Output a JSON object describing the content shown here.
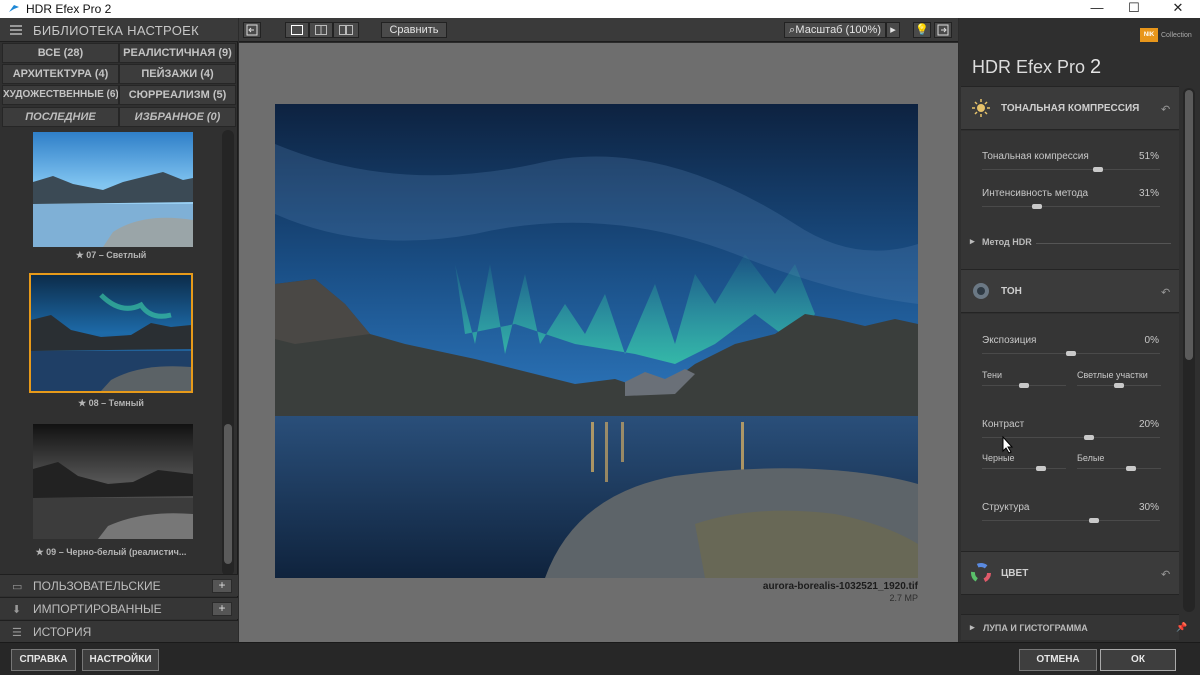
{
  "window": {
    "title": "HDR Efex Pro 2",
    "minimize": "—",
    "maximize": "☐",
    "close": "✕"
  },
  "library": {
    "header": "БИБЛИОТЕКА НАСТРОЕК",
    "categories": [
      "ВСЕ (28)",
      "РЕАЛИСТИЧНАЯ (9)",
      "АРХИТЕКТУРА (4)",
      "ПЕЙЗАЖИ (4)",
      "ХУДОЖЕСТВЕННЫЕ (6)",
      "СЮРРЕАЛИЗМ (5)",
      "ПОСЛЕДНИЕ",
      "ИЗБРАННОЕ (0)"
    ],
    "presets": [
      {
        "caption": "★ 07 – Светлый"
      },
      {
        "caption": "★ 08 – Темный"
      },
      {
        "caption": "★ 09 – Черно-белый (реалистич..."
      }
    ],
    "sections": [
      {
        "label": "ПОЛЬЗОВАТЕЛЬСКИЕ",
        "icon": "drawer-icon",
        "plus": "+"
      },
      {
        "label": "ИМПОРТИРОВАННЫЕ",
        "icon": "import-icon",
        "plus": "+"
      },
      {
        "label": "ИСТОРИЯ",
        "icon": "history-icon"
      }
    ]
  },
  "toolbar": {
    "compare": "Сравнить",
    "zoom": "Масштаб (100%)",
    "zoom_arrow": "▸"
  },
  "image": {
    "filename": "aurora-borealis-1032521_1920.tif",
    "size": "2.7 MP"
  },
  "panel": {
    "brand": "NIK",
    "brand_sub": "Collection",
    "product": "HDR Efex Pro",
    "version": "2",
    "tonal": {
      "title": "ТОНАЛЬНАЯ КОМПРЕССИЯ",
      "sliders": [
        {
          "label": "Тональная компрессия",
          "value": "51%",
          "level": 0.65
        },
        {
          "label": "Интенсивность метода",
          "value": "31%",
          "level": 0.31
        }
      ],
      "method": "Метод HDR"
    },
    "tone": {
      "title": "ТОН",
      "exposure": {
        "label": "Экспозиция",
        "value": "0%",
        "level": 0.5
      },
      "shadows": {
        "label": "Тени",
        "level": 0.5
      },
      "highlights": {
        "label": "Светлые участки",
        "level": 0.5
      },
      "contrast": {
        "label": "Контраст",
        "value": "20%",
        "level": 0.6
      },
      "blacks": {
        "label": "Черные",
        "level": 0.5
      },
      "whites": {
        "label": "Белые",
        "level": 0.5
      },
      "structure": {
        "label": "Структура",
        "value": "30%",
        "level": 0.63
      }
    },
    "color": {
      "title": "ЦВЕТ"
    },
    "loupe": {
      "title": "ЛУПА И ГИСТОГРАММА"
    }
  },
  "buttons": {
    "help": "СПРАВКА",
    "settings": "НАСТРОЙКИ",
    "cancel": "ОТМЕНА",
    "ok": "ОК"
  },
  "colors": {
    "accent": "#e79a1a",
    "panel": "#303030",
    "canvas": "#6e6e6e"
  }
}
